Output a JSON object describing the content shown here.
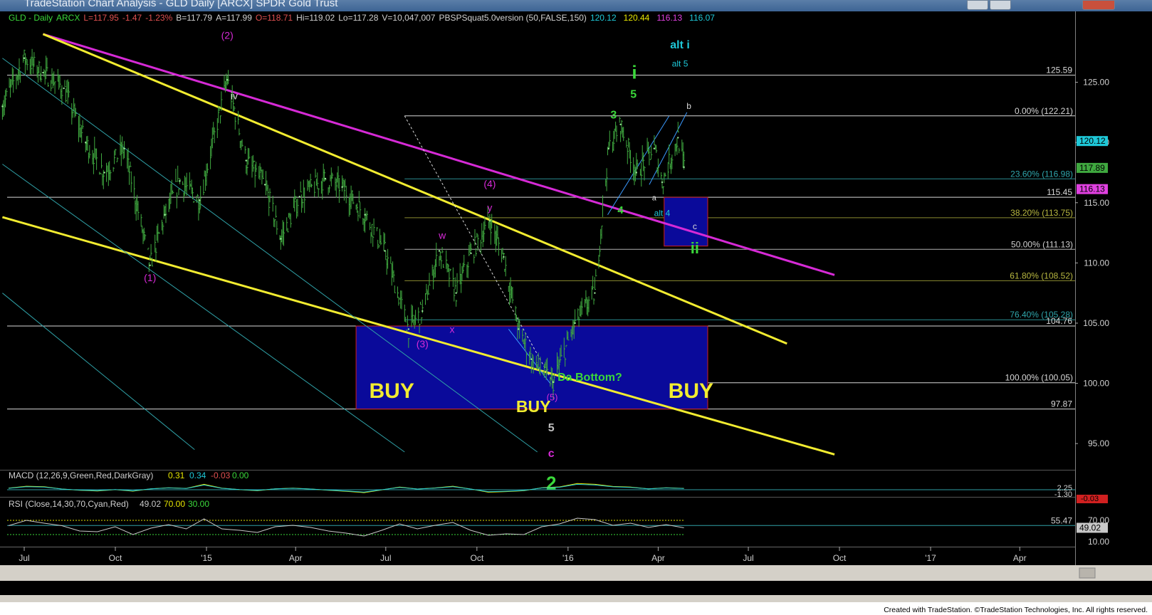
{
  "window": {
    "title": "TradeStation Chart Analysis - GLD Daily [ARCX] SPDR Gold Trust"
  },
  "footer": {
    "credit": "Created with TradeStation. ©TradeStation Technologies, Inc. All rights reserved."
  },
  "colors": {
    "background": "#000000",
    "bars": "#3fa83f",
    "magenta": "#d62ad6",
    "yellow": "#f2ec30",
    "teal": "#2fa0a6",
    "box": "#0a0a9a",
    "green_label": "#3ad83a",
    "cyan_label": "#1ec8d8",
    "white_line": "#d8d8d8"
  },
  "chart_data": {
    "type": "line",
    "symbol": "GLD",
    "header": {
      "symbol": "GLD - Daily",
      "exchange": "ARCX",
      "last": "L=117.95",
      "change": "-1.47",
      "change_pct": "-1.23%",
      "bid": "B=117.79",
      "ask": "A=117.99",
      "open": "O=118.71",
      "high": "Hi=119.02",
      "low": "Lo=117.28",
      "volume": "V=10,047,007",
      "study": "PBSPSquat5.0version (50,FALSE,150)",
      "study_values": [
        {
          "value": "120.12",
          "color": "#1ec8d8"
        },
        {
          "value": "120.44",
          "color": "#e6e600"
        },
        {
          "value": "116.13",
          "color": "#e040e0"
        },
        {
          "value": "116.07",
          "color": "#1ec8d8"
        }
      ]
    },
    "x_ticks": [
      "Jul",
      "Oct",
      "'15",
      "Apr",
      "Jul",
      "Oct",
      "'16",
      "Apr",
      "Jul",
      "Oct",
      "'17",
      "Apr"
    ],
    "y_ticks": [
      "125.00",
      "120.00",
      "115.00",
      "110.00",
      "105.00",
      "100.00",
      "95.00"
    ],
    "ylim": [
      93.0,
      130.0
    ],
    "price_series": {
      "name": "GLD",
      "x": [
        "2014-06-09",
        "2014-07-01",
        "2014-07-20",
        "2014-08-10",
        "2014-09-01",
        "2014-09-20",
        "2014-10-10",
        "2014-11-05",
        "2014-11-20",
        "2014-12-05",
        "2014-12-25",
        "2015-01-22",
        "2015-02-10",
        "2015-03-01",
        "2015-03-17",
        "2015-04-05",
        "2015-05-01",
        "2015-05-18",
        "2015-06-10",
        "2015-06-30",
        "2015-07-24",
        "2015-08-07",
        "2015-08-24",
        "2015-09-10",
        "2015-09-25",
        "2015-10-14",
        "2015-10-28",
        "2015-11-12",
        "2015-11-25",
        "2015-12-17",
        "2016-01-08",
        "2016-01-28",
        "2016-02-11",
        "2016-02-23",
        "2016-03-10",
        "2016-03-28",
        "2016-04-05",
        "2016-04-21",
        "2016-04-27"
      ],
      "y": [
        123.0,
        127.0,
        125.8,
        124.5,
        120.0,
        117.5,
        119.5,
        109.8,
        114.0,
        116.8,
        115.2,
        125.2,
        118.5,
        116.5,
        112.0,
        115.5,
        117.0,
        116.3,
        114.0,
        111.0,
        104.5,
        106.0,
        111.0,
        107.5,
        110.8,
        113.5,
        110.5,
        104.5,
        102.0,
        100.1,
        105.0,
        107.5,
        119.5,
        121.5,
        117.5,
        119.5,
        116.7,
        120.4,
        117.95
      ]
    },
    "horizontal_lines": [
      {
        "value": 125.59,
        "label": "125.59",
        "color": "#d8d8d8"
      },
      {
        "value": 115.45,
        "label": "115.45",
        "color": "#d8d8d8"
      },
      {
        "value": 104.76,
        "label": "104.76",
        "color": "#d8d8d8"
      },
      {
        "value": 97.87,
        "label": "97.87",
        "color": "#d8d8d8"
      }
    ],
    "fib_levels": [
      {
        "value": 122.21,
        "label": "0.00% (122.21)",
        "color": "#d8d8d8",
        "label_color": "#d8d8d8"
      },
      {
        "value": 116.98,
        "label": "23.60% (116.98)",
        "color": "#2a8c90",
        "label_color": "#2fa6ac"
      },
      {
        "value": 113.75,
        "label": "38.20% (113.75)",
        "color": "#8a8a30",
        "label_color": "#b8b840"
      },
      {
        "value": 111.13,
        "label": "50.00% (111.13)",
        "color": "#b0b0b0",
        "label_color": "#d0d0d0"
      },
      {
        "value": 108.52,
        "label": "61.80% (108.52)",
        "color": "#8a8a30",
        "label_color": "#b8b840"
      },
      {
        "value": 105.28,
        "label": "76.40% (105.28)",
        "color": "#2a8c90",
        "label_color": "#2fa6ac"
      },
      {
        "value": 100.05,
        "label": "100.00% (100.05)",
        "color": "#d8d8d8",
        "label_color": "#d8d8d8"
      }
    ],
    "fib_start_date": "2015-07-20",
    "trend_lines": [
      {
        "name": "magenta-resistance",
        "color": "#d62ad6",
        "points": [
          [
            "2014-07-20",
            129.0
          ],
          [
            "2016-09-26",
            109.0
          ]
        ]
      },
      {
        "name": "yellow-upper",
        "color": "#f2ec30",
        "points": [
          [
            "2014-07-20",
            129.0
          ],
          [
            "2016-08-09",
            103.3
          ]
        ]
      },
      {
        "name": "yellow-lower",
        "color": "#f2ec30",
        "points": [
          [
            "2014-06-09",
            113.8
          ],
          [
            "2016-09-26",
            94.1
          ]
        ]
      },
      {
        "name": "teal-channel-1",
        "color": "#2fa0a6",
        "points": [
          [
            "2014-06-09",
            127.0
          ],
          [
            "2015-12-01",
            94.3
          ]
        ]
      },
      {
        "name": "teal-channel-2",
        "color": "#2fa0a6",
        "points": [
          [
            "2014-06-09",
            118.2
          ],
          [
            "2015-07-20",
            94.3
          ]
        ]
      },
      {
        "name": "teal-channel-3",
        "color": "#2fa0a6",
        "points": [
          [
            "2014-06-09",
            107.5
          ],
          [
            "2014-12-20",
            94.5
          ]
        ]
      },
      {
        "name": "wave-c-channel-lower",
        "color": "#3a9aff",
        "points": [
          [
            "2015-11-02",
            104.5
          ],
          [
            "2015-12-14",
            100.0
          ]
        ]
      },
      {
        "name": "wave-ii-channel-upper",
        "color": "#3a9aff",
        "points": [
          [
            "2016-03-23",
            116.5
          ],
          [
            "2016-04-30",
            122.5
          ]
        ]
      },
      {
        "name": "wave-ii-channel-lower",
        "color": "#3a9aff",
        "points": [
          [
            "2016-02-10",
            114.0
          ],
          [
            "2016-04-12",
            122.2
          ]
        ]
      }
    ],
    "dotted_line": {
      "points": [
        [
          "2015-07-20",
          122.21
        ],
        [
          "2015-12-17",
          100.05
        ]
      ],
      "color": "#d8d8d8"
    },
    "boxes": [
      {
        "name": "buy-zone",
        "from": "2015-06-01",
        "to": "2016-05-21",
        "top": 104.76,
        "bottom": 97.87
      },
      {
        "name": "wave-ii-zone",
        "from": "2016-04-07",
        "to": "2016-05-21",
        "top": 115.45,
        "bottom": 111.4
      }
    ],
    "annotations": [
      {
        "text": "(1)",
        "date": "2014-11-05",
        "price": 108.5,
        "color": "#d62ad6",
        "size": 14
      },
      {
        "text": "(2)",
        "date": "2015-01-22",
        "price": 128.6,
        "color": "#d62ad6",
        "size": 14
      },
      {
        "text": "iv",
        "date": "2015-01-29",
        "price": 123.6,
        "color": "#d8d8d8",
        "size": 14
      },
      {
        "text": "(3)",
        "date": "2015-08-07",
        "price": 103.0,
        "color": "#d62ad6",
        "size": 14
      },
      {
        "text": "w",
        "date": "2015-08-27",
        "price": 112.0,
        "color": "#d62ad6",
        "size": 14
      },
      {
        "text": "x",
        "date": "2015-09-06",
        "price": 104.2,
        "color": "#d62ad6",
        "size": 14
      },
      {
        "text": "(4)",
        "date": "2015-10-14",
        "price": 116.3,
        "color": "#d62ad6",
        "size": 14
      },
      {
        "text": "y",
        "date": "2015-10-14",
        "price": 114.3,
        "color": "#d62ad6",
        "size": 14
      },
      {
        "text": "(5)",
        "date": "2015-12-16",
        "price": 98.6,
        "color": "#d62ad6",
        "size": 13
      },
      {
        "text": "5",
        "date": "2015-12-15",
        "price": 96.0,
        "color": "#c0c0c0",
        "size": 16,
        "bold": true
      },
      {
        "text": "c",
        "date": "2015-12-15",
        "price": 93.9,
        "color": "#d62ad6",
        "size": 16,
        "bold": true
      },
      {
        "text": "2",
        "date": "2015-12-15",
        "price": 91.2,
        "color": "#3ad83a",
        "size": 26,
        "bold": true
      },
      {
        "text": "BUY",
        "date": "2015-07-07",
        "price": 98.8,
        "color": "#f2ec30",
        "size": 30,
        "bold": true
      },
      {
        "text": "BUY",
        "date": "2015-11-27",
        "price": 97.6,
        "color": "#f2ec30",
        "size": 23,
        "bold": true
      },
      {
        "text": "BUY",
        "date": "2016-05-04",
        "price": 98.8,
        "color": "#f2ec30",
        "size": 30,
        "bold": true
      },
      {
        "text": "Da Bottom?",
        "date": "2016-01-23",
        "price": 100.2,
        "color": "#3ad83a",
        "size": 16,
        "bold": true
      },
      {
        "text": "3",
        "date": "2016-02-16",
        "price": 122.0,
        "color": "#3ad83a",
        "size": 16,
        "bold": true
      },
      {
        "text": "5",
        "date": "2016-03-07",
        "price": 123.7,
        "color": "#3ad83a",
        "size": 16,
        "bold": true
      },
      {
        "text": "i",
        "date": "2016-03-08",
        "price": 125.3,
        "color": "#3ad83a",
        "size": 26,
        "bold": true
      },
      {
        "text": "4",
        "date": "2016-02-23",
        "price": 114.1,
        "color": "#3ad83a",
        "size": 15,
        "bold": true
      },
      {
        "text": "a",
        "date": "2016-03-28",
        "price": 115.2,
        "color": "#d8d8d8",
        "size": 11
      },
      {
        "text": "b",
        "date": "2016-05-02",
        "price": 122.8,
        "color": "#d8d8d8",
        "size": 12
      },
      {
        "text": "alt 4",
        "date": "2016-04-05",
        "price": 113.9,
        "color": "#1ec8d8",
        "size": 12
      },
      {
        "text": "c",
        "date": "2016-05-08",
        "price": 112.8,
        "color": "#d8d8d8",
        "size": 12
      },
      {
        "text": "ii",
        "date": "2016-05-08",
        "price": 110.8,
        "color": "#3ad83a",
        "size": 22,
        "bold": true
      },
      {
        "text": "alt i",
        "date": "2016-04-23",
        "price": 127.8,
        "color": "#1ec8d8",
        "size": 16,
        "bold": true
      },
      {
        "text": "alt 5",
        "date": "2016-04-23",
        "price": 126.3,
        "color": "#1ec8d8",
        "size": 12
      }
    ],
    "price_labels": [
      {
        "text": "120.12",
        "price": 120.12,
        "bg": "#1ec8d8",
        "fg": "#000000",
        "hidden_text": "120.44"
      },
      {
        "text": "117.89",
        "price": 117.89,
        "bg": "#3fa83f",
        "fg": "#000000"
      },
      {
        "text": "116.13",
        "price": 116.13,
        "bg": "#e040e0",
        "fg": "#000000"
      }
    ],
    "macd": {
      "title": "MACD (12,26,9,Green,Red,DarkGray)",
      "values": [
        {
          "value": "0.31",
          "color": "#e6e600"
        },
        {
          "value": "0.34",
          "color": "#1ec8d8"
        },
        {
          "value": "-0.03",
          "color": "#e05050"
        },
        {
          "value": "0.00",
          "color": "#3ad83a"
        }
      ],
      "axis_labels": [
        "2.25",
        "-1.30"
      ],
      "current_label": "-0.03",
      "line_values": [
        0.4,
        1.3,
        1.1,
        0.0,
        -0.6,
        -0.9,
        -0.3,
        -1.0,
        0.1,
        0.6,
        0.3,
        2.2,
        0.4,
        -0.3,
        -0.8,
        0.1,
        0.4,
        0.0,
        -0.6,
        -1.1,
        -1.7,
        -0.4,
        0.9,
        0.0,
        0.5,
        1.3,
        0.0,
        -1.5,
        -1.2,
        -0.8,
        0.6,
        1.0,
        2.6,
        2.2,
        1.2,
        0.9,
        0.1,
        0.6,
        0.31
      ]
    },
    "rsi": {
      "title": "RSI (Close,14,30,70,Cyan,Red)",
      "values": [
        {
          "value": "49.02",
          "color": "#c8c8c8"
        },
        {
          "value": "70.00",
          "color": "#e6e600"
        },
        {
          "value": "30.00",
          "color": "#3ad83a"
        }
      ],
      "axis_labels": [
        "70.00",
        "10.00"
      ],
      "marker_label": "55.47",
      "current_label": "49.02",
      "line_values": [
        55,
        70,
        62,
        55,
        40,
        38,
        52,
        30,
        48,
        58,
        46,
        74,
        46,
        42,
        36,
        52,
        56,
        50,
        40,
        34,
        26,
        42,
        60,
        46,
        56,
        64,
        42,
        28,
        32,
        30,
        52,
        60,
        76,
        72,
        56,
        62,
        50,
        58,
        49
      ]
    }
  }
}
